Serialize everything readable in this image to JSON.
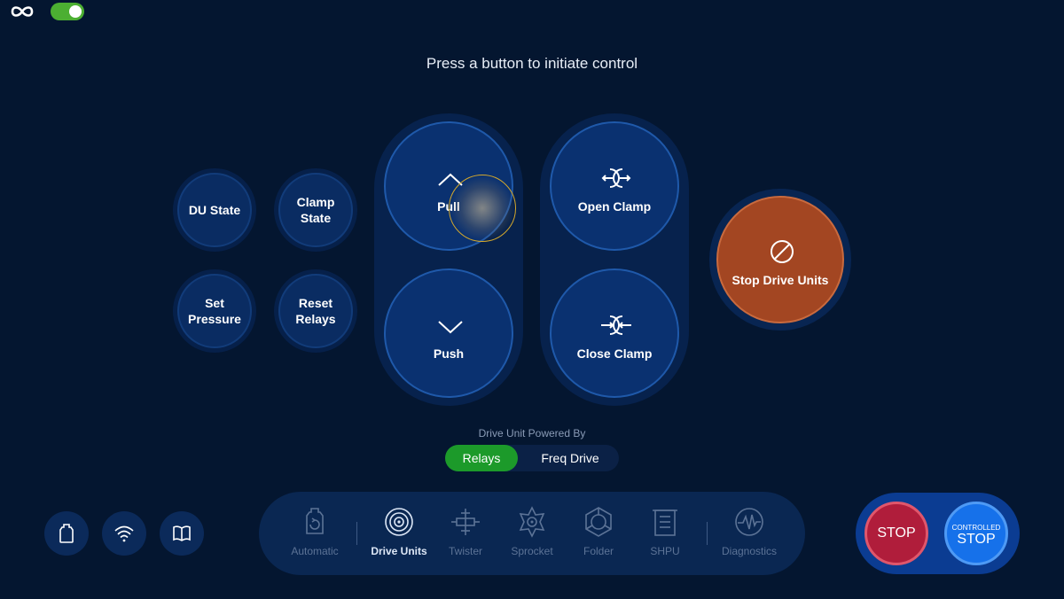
{
  "header": {
    "prompt": "Press a button to initiate control"
  },
  "status_buttons": {
    "du_state": "DU State",
    "clamp_state": "Clamp\nState",
    "set_pressure": "Set\nPressure",
    "reset_relays": "Reset\nRelays"
  },
  "controls": {
    "pull": "Pull",
    "push": "Push",
    "open_clamp": "Open Clamp",
    "close_clamp": "Close Clamp",
    "stop_drive_units": "Stop Drive Units"
  },
  "power": {
    "label": "Drive Unit Powered By",
    "options": [
      "Relays",
      "Freq Drive"
    ],
    "selected": "Relays"
  },
  "nav": {
    "items": [
      {
        "label": "Automatic",
        "icon": "automatic-icon"
      },
      {
        "label": "Drive Units",
        "icon": "drive-units-icon"
      },
      {
        "label": "Twister",
        "icon": "twister-icon"
      },
      {
        "label": "Sprocket",
        "icon": "sprocket-icon"
      },
      {
        "label": "Folder",
        "icon": "folder-icon"
      },
      {
        "label": "SHPU",
        "icon": "shpu-icon"
      },
      {
        "label": "Diagnostics",
        "icon": "diagnostics-icon"
      }
    ],
    "active": "Drive Units"
  },
  "stop_panel": {
    "stop": "STOP",
    "controlled_top": "CONTROLLED",
    "controlled_main": "STOP"
  },
  "colors": {
    "background": "#041630",
    "accent_green": "#1c9a2a",
    "stop_drive_units": "#a34622",
    "emergency_stop": "#b01d3b",
    "controlled_stop": "#1671ea"
  }
}
